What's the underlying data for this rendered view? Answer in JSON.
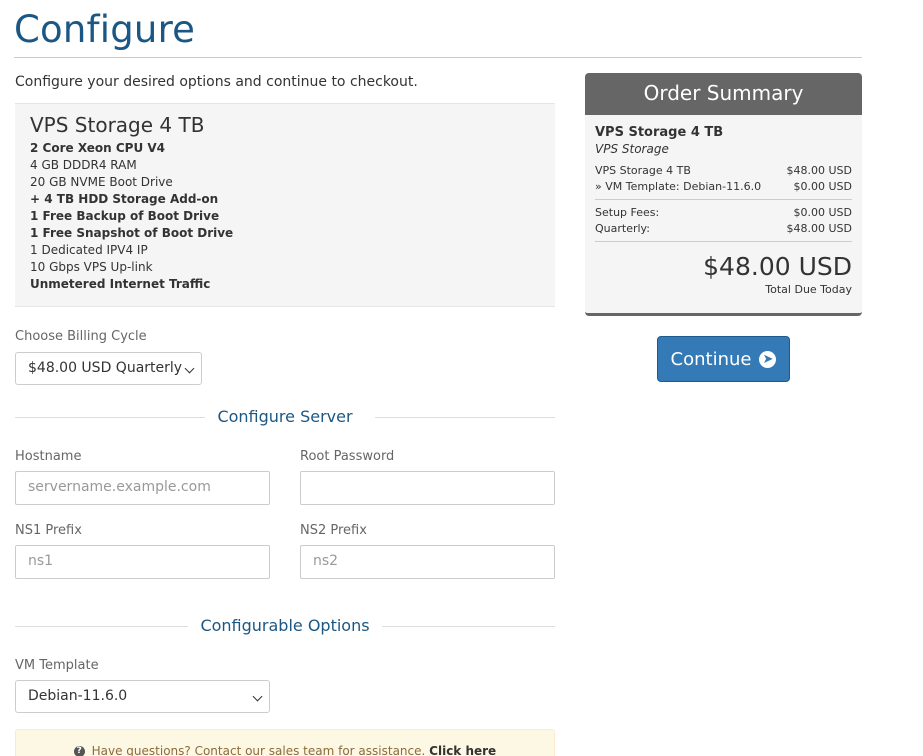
{
  "page": {
    "title": "Configure",
    "intro": "Configure your desired options and continue to checkout."
  },
  "product": {
    "name": "VPS Storage 4 TB",
    "features": [
      {
        "text": "2 Core Xeon CPU V4",
        "bold": true
      },
      {
        "text": "4 GB DDDR4 RAM",
        "bold": false
      },
      {
        "text": "20 GB NVME Boot Drive",
        "bold": false
      },
      {
        "text": "+ 4 TB HDD Storage Add-on",
        "bold": true
      },
      {
        "text": "1 Free Backup of Boot Drive",
        "bold": true
      },
      {
        "text": "1 Free Snapshot of Boot Drive",
        "bold": true
      },
      {
        "text": "1 Dedicated IPV4 IP",
        "bold": false
      },
      {
        "text": "10 Gbps VPS Up-link",
        "bold": false
      },
      {
        "text": "Unmetered Internet Traffic",
        "bold": true
      }
    ]
  },
  "billing": {
    "label": "Choose Billing Cycle",
    "selected": "$48.00 USD Quarterly"
  },
  "configure_server": {
    "heading": "Configure Server",
    "hostname_label": "Hostname",
    "hostname_placeholder": "servername.example.com",
    "root_password_label": "Root Password",
    "root_password_value": "",
    "ns1_label": "NS1 Prefix",
    "ns1_placeholder": "ns1",
    "ns2_label": "NS2 Prefix",
    "ns2_placeholder": "ns2"
  },
  "configurable_options": {
    "heading": "Configurable Options",
    "vm_template_label": "VM Template",
    "vm_template_selected": "Debian-11.6.0"
  },
  "summary": {
    "heading": "Order Summary",
    "product_name": "VPS Storage 4 TB",
    "product_group": "VPS Storage",
    "lines": [
      {
        "label": "VPS Storage 4 TB",
        "amount": "$48.00 USD"
      },
      {
        "label": "» VM Template: Debian-11.6.0",
        "amount": "$0.00 USD"
      }
    ],
    "fees": [
      {
        "label": "Setup Fees:",
        "amount": "$0.00 USD"
      },
      {
        "label": "Quarterly:",
        "amount": "$48.00 USD"
      }
    ],
    "total": "$48.00 USD",
    "total_label": "Total Due Today"
  },
  "continue_label": "Continue",
  "help": {
    "text": "Have questions? Contact our sales team for assistance.",
    "link": "Click here"
  }
}
